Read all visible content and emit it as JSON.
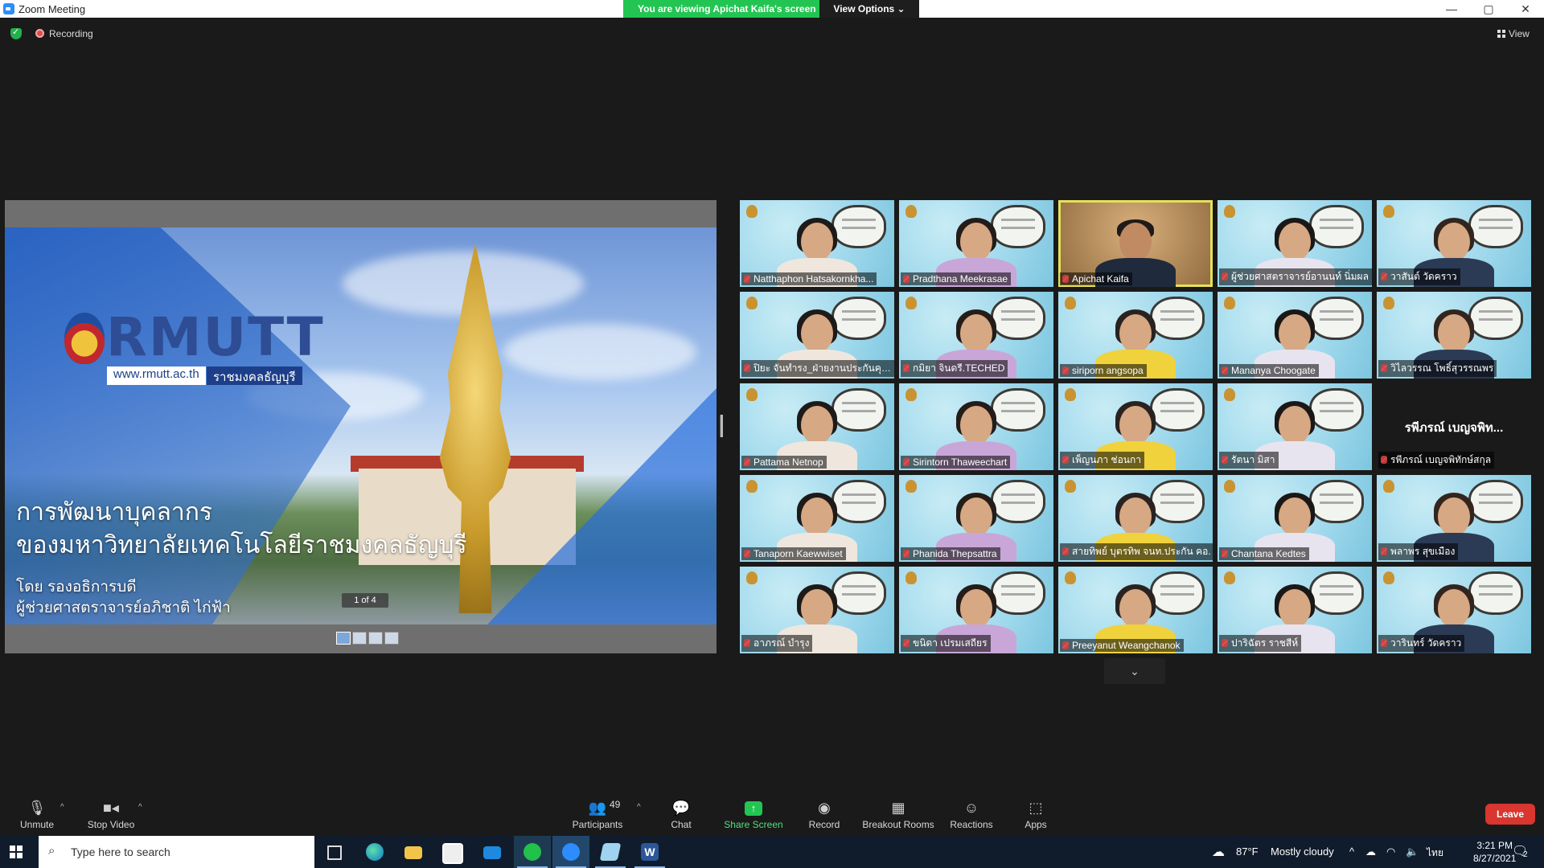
{
  "window": {
    "title": "Zoom Meeting",
    "minimize": "—",
    "maximize": "▢",
    "close": "✕"
  },
  "share_banner": {
    "message": "You are viewing Apichat Kaifa's screen",
    "view_options": "View Options ⌄"
  },
  "top_bar": {
    "recording": "Recording",
    "view": "View"
  },
  "slide": {
    "logo_text": "RMUTT",
    "logo_url": "www.rmutt.ac.th",
    "logo_thai": "ราชมงคลธัญบุรี",
    "title_line1": "การพัฒนาบุคลากร",
    "title_line2": "ของมหาวิทยาลัยเทคโนโลยีราชมงคลธัญบุรี",
    "by_line1": "โดย รองอธิการบดี",
    "by_line2": "ผู้ช่วยศาสตราจารย์อภิชาติ ไก่ฟ้า",
    "page_indicator": "1 of 4"
  },
  "participants": [
    {
      "name": "Natthaphon Hatsakornkha..."
    },
    {
      "name": "Pradthana Meekrasae"
    },
    {
      "name": "Apichat Kaifa"
    },
    {
      "name": "ผู้ช่วยศาสตราจารย์อานนท์ นิ่มผล"
    },
    {
      "name": "วาสันต์ วัดคราว"
    },
    {
      "name": "ปิยะ จันทำรง_ฝ่ายงานประกันคุณ..."
    },
    {
      "name": "กมิยา จินดรี.TECHED"
    },
    {
      "name": "siriporn angsopa"
    },
    {
      "name": "Mananya Choogate"
    },
    {
      "name": "วิไลวรรณ โพธิ์สุวรรณพร"
    },
    {
      "name": "Pattama Netnop"
    },
    {
      "name": "Sirintorn Thaweechart"
    },
    {
      "name": "เพ็ญนภา ช่อนกา"
    },
    {
      "name": "รัตนา มิสา"
    },
    {
      "name": "รพีภรณ์ เบญจพิทักษ์สกุล",
      "big": "รพีภรณ์ เบญจพิท..."
    },
    {
      "name": "Tanaporn Kaewwiset"
    },
    {
      "name": "Phanida Thepsattra"
    },
    {
      "name": "สายทิพย์ บุตรทิพ จนท.ประกัน คอ."
    },
    {
      "name": "Chantana Kedtes"
    },
    {
      "name": "พลาพร สุขเมือง"
    },
    {
      "name": "อาภรณ์ บำรุง"
    },
    {
      "name": "ขนิดา เปรมเสถียร"
    },
    {
      "name": "Preeyanut Weangchanok"
    },
    {
      "name": "ปาริฉัตร ราชสีห์"
    },
    {
      "name": "วารินทร์ วัดคราว"
    }
  ],
  "toolbar": {
    "unmute": "Unmute",
    "stop_video": "Stop Video",
    "participants_count": "49",
    "participants": "Participants",
    "chat": "Chat",
    "share_screen": "Share Screen",
    "record": "Record",
    "breakout_rooms": "Breakout Rooms",
    "reactions": "Reactions",
    "apps": "Apps",
    "leave": "Leave"
  },
  "taskbar": {
    "search_placeholder": "Type here to search",
    "weather_temp": "87°F",
    "weather_desc": "Mostly cloudy",
    "lang": "ไทย",
    "time": "3:21 PM",
    "date": "8/27/2021",
    "notifications": "2"
  },
  "colors": {
    "share_green": "#23c552",
    "leave_red": "#d8362f",
    "zoom_blue": "#2d8cff"
  }
}
